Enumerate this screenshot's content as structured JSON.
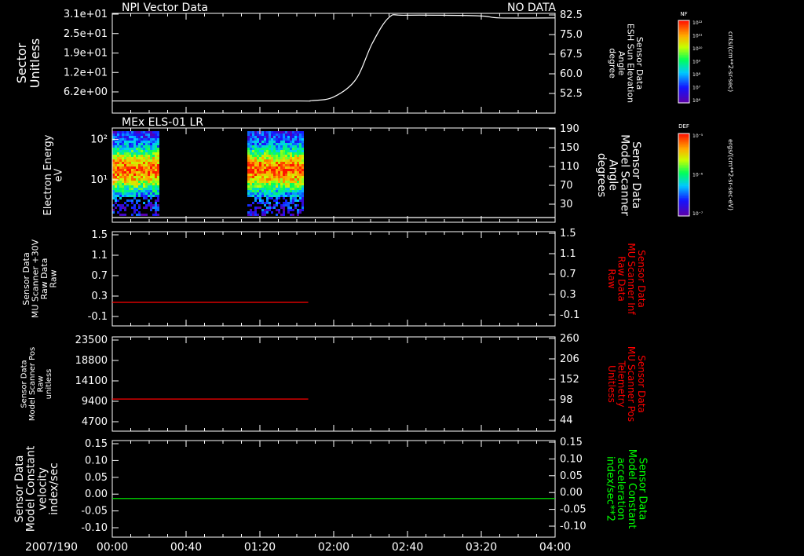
{
  "date_label": "2007/190",
  "time_ticks": [
    "00:00",
    "00:40",
    "01:20",
    "02:00",
    "02:40",
    "03:20",
    "04:00"
  ],
  "colors": {
    "white": "#ffffff",
    "red": "#ff0000",
    "green": "#00ff00",
    "background": "#000000"
  },
  "colorbars": [
    {
      "tag": "NF",
      "units": "cnts/(cm**2-sr-sec)",
      "tick_labels": [
        "10¹²",
        "10¹¹",
        "10¹⁰",
        "10⁹",
        "10⁸",
        "10⁷",
        "10⁶"
      ]
    },
    {
      "tag": "DEF",
      "units": "ergs/(cm**2-sr-sec-eV)",
      "tick_labels": [
        "10⁻⁵",
        "10⁻⁶",
        "10⁻⁷"
      ]
    }
  ],
  "chart_data": [
    {
      "type": "line",
      "title": "NPI Vector Data",
      "status": "NO DATA",
      "left_axis": {
        "label_lines": [
          "Sector",
          "Unitless"
        ],
        "tick_labels": [
          "3.1e+01",
          "2.5e+01",
          "1.9e+01",
          "1.2e+01",
          "6.2e+00"
        ]
      },
      "right_axis": {
        "label_lines": [
          "Sensor Data",
          "ESH Sun Elevation",
          "Angle",
          "degree"
        ],
        "ylim": [
          46,
          83
        ],
        "tick_labels": [
          "82.5",
          "75.0",
          "67.5",
          "60.0",
          "52.5"
        ]
      },
      "xlim_hours": [
        0,
        4
      ],
      "series": [
        {
          "color": "#ffffff",
          "x": [
            0.0,
            1.6,
            1.8,
            2.0,
            2.2,
            2.35,
            2.5,
            2.65,
            3.3,
            3.5,
            4.0
          ],
          "y": [
            50.5,
            50.5,
            50.6,
            52.0,
            58.5,
            72.0,
            81.5,
            82.3,
            82.1,
            81.3,
            81.3
          ]
        }
      ]
    },
    {
      "type": "heatmap",
      "title": "MEx ELS-01 LR",
      "left_axis": {
        "label_lines": [
          "Electron Energy",
          "eV"
        ],
        "tick_labels": [
          "10²",
          "10¹"
        ]
      },
      "right_axis": {
        "label_lines": [
          "Sensor Data",
          "Model Scanner",
          "Angle",
          "degrees"
        ],
        "tick_labels": [
          "190",
          "150",
          "110",
          "70",
          "30"
        ]
      },
      "xlim_hours": [
        0,
        4
      ],
      "data_blocks_hours": [
        [
          0.0,
          0.42
        ],
        [
          1.22,
          1.72
        ]
      ],
      "baseline": {
        "color": "#ffffff",
        "x": [
          0,
          4
        ],
        "y_fraction": 0.05
      }
    },
    {
      "type": "line",
      "left_axis": {
        "label_lines": [
          "Sensor Data",
          "MU Scanner +30V",
          "Raw Data",
          "Raw"
        ],
        "tick_labels": [
          "1.5",
          "1.1",
          "0.7",
          "0.3",
          "-0.1"
        ]
      },
      "right_axis": {
        "label_lines": [
          "Sensor Data",
          "MU Scanner Inf",
          "Raw Data",
          "Raw"
        ],
        "tick_labels": [
          "1.5",
          "1.1",
          "0.7",
          "0.3",
          "-0.1"
        ]
      },
      "ylim": [
        -0.5,
        1.5
      ],
      "xlim_hours": [
        0,
        4
      ],
      "series": [
        {
          "color": "#ff0000",
          "x": [
            0.0,
            1.77
          ],
          "y": [
            0.0,
            0.0
          ]
        }
      ]
    },
    {
      "type": "line",
      "left_axis": {
        "label_lines": [
          "Sensor Data",
          "Model Scanner Pos",
          "Raw",
          "unitless"
        ],
        "tick_labels": [
          "23500",
          "18800",
          "14100",
          "9400",
          "4700"
        ]
      },
      "right_axis": {
        "label_lines": [
          "Sensor Data",
          "MU Scanner Pos",
          "Telemetry",
          "Unitless"
        ],
        "tick_labels": [
          "260",
          "206",
          "152",
          "98",
          "44"
        ]
      },
      "ylim": [
        0,
        23500
      ],
      "xlim_hours": [
        0,
        4
      ],
      "series": [
        {
          "color": "#ff0000",
          "x": [
            0.0,
            1.77
          ],
          "y": [
            8000,
            8000
          ]
        }
      ]
    },
    {
      "type": "line",
      "left_axis": {
        "label_lines": [
          "Sensor Data",
          "Model Constant",
          "velocity",
          "index/sec"
        ],
        "tick_labels": [
          "0.15",
          "0.10",
          "0.05",
          "0.00",
          "-0.05",
          "-0.10"
        ]
      },
      "right_axis": {
        "label_lines": [
          "Sensor Data",
          "Model Constant",
          "acceleration",
          "index/sec**2"
        ],
        "tick_labels": [
          "0.15",
          "0.10",
          "0.05",
          "0.00",
          "-0.05",
          "-0.10"
        ]
      },
      "ylim": [
        -0.1,
        0.15
      ],
      "xlim_hours": [
        0,
        4
      ],
      "series": [
        {
          "color": "#00ff00",
          "x": [
            0.0,
            4.0
          ],
          "y": [
            0.0,
            0.0
          ]
        }
      ]
    }
  ]
}
